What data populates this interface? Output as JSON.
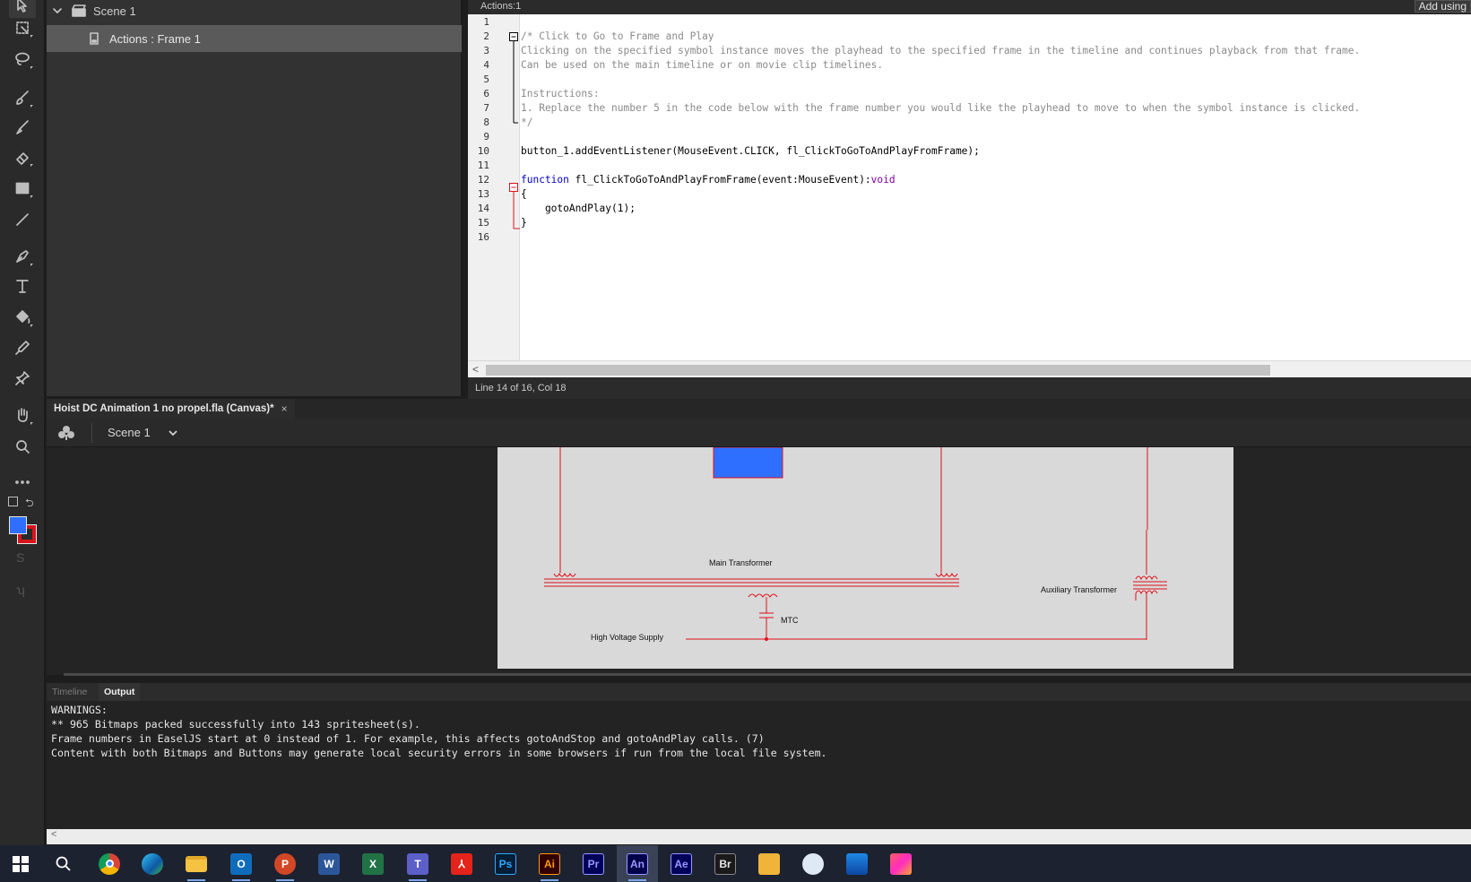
{
  "tree": {
    "scene": "Scene 1",
    "frame_item": "Actions : Frame 1"
  },
  "actions_panel": {
    "tab": "Actions:1",
    "add_using": "Add using",
    "line_numbers": [
      "1",
      "2",
      "3",
      "4",
      "5",
      "6",
      "7",
      "8",
      "9",
      "10",
      "11",
      "12",
      "13",
      "14",
      "15",
      "16"
    ],
    "code": {
      "l2": "/* Click to Go to Frame and Play",
      "l3": "Clicking on the specified symbol instance moves the playhead to the specified frame in the timeline and continues playback from that frame.",
      "l4": "Can be used on the main timeline or on movie clip timelines.",
      "l6": "Instructions:",
      "l7": "1. Replace the number 5 in the code below with the frame number you would like the playhead to move to when the symbol instance is clicked.",
      "l8": "*/",
      "l10": "button_1.addEventListener(MouseEvent.CLICK, fl_ClickToGoToAndPlayFromFrame);",
      "l12_kw": "function",
      "l12_rest": " fl_ClickToGoToAndPlayFromFrame(event:MouseEvent):",
      "l12_type": "void",
      "l13": "{",
      "l14": "    gotoAndPlay(1);",
      "l15": "}"
    },
    "status": "Line 14 of 16, Col 18"
  },
  "document": {
    "tab_title": "Hoist DC Animation 1 no propel.fla (Canvas)*",
    "close": "×",
    "scene_selector": "Scene 1"
  },
  "stage": {
    "labels": {
      "main_transformer": "Main Transformer",
      "auxiliary_transformer": "Auxiliary Transformer",
      "mtc": "MTC",
      "high_voltage_supply": "High Voltage Supply"
    },
    "colors": {
      "wire": "#e0101c",
      "block": "#2f6fff",
      "background": "#d9d9d9"
    }
  },
  "output_panel": {
    "tabs": [
      "Timeline",
      "Output"
    ],
    "active_tab": "Output",
    "lines": [
      "WARNINGS:",
      "** 965 Bitmaps packed successfully into 143 spritesheet(s).",
      "Frame numbers in EaselJS start at 0 instead of 1. For example, this affects gotoAndStop and gotoAndPlay calls. (7)",
      "Content with both Bitmaps and Buttons may generate local security errors in some browsers if run from the local file system."
    ]
  },
  "taskbar": {
    "apps": [
      {
        "name": "Start",
        "label": ""
      },
      {
        "name": "Search",
        "label": ""
      },
      {
        "name": "Chrome",
        "label": ""
      },
      {
        "name": "Edge",
        "label": ""
      },
      {
        "name": "File Explorer",
        "label": ""
      },
      {
        "name": "Outlook",
        "label": "O"
      },
      {
        "name": "PowerPoint",
        "label": "P"
      },
      {
        "name": "Word",
        "label": "W"
      },
      {
        "name": "Excel",
        "label": "X"
      },
      {
        "name": "Teams",
        "label": "T"
      },
      {
        "name": "Acrobat",
        "label": ""
      },
      {
        "name": "Photoshop",
        "label": "Ps"
      },
      {
        "name": "Illustrator",
        "label": "Ai"
      },
      {
        "name": "Premiere",
        "label": "Pr"
      },
      {
        "name": "Animate",
        "label": "An"
      },
      {
        "name": "After Effects",
        "label": "Ae"
      },
      {
        "name": "Bridge",
        "label": "Br"
      },
      {
        "name": "App",
        "label": ""
      },
      {
        "name": "App",
        "label": ""
      },
      {
        "name": "App",
        "label": ""
      },
      {
        "name": "Creative Cloud",
        "label": ""
      }
    ]
  }
}
